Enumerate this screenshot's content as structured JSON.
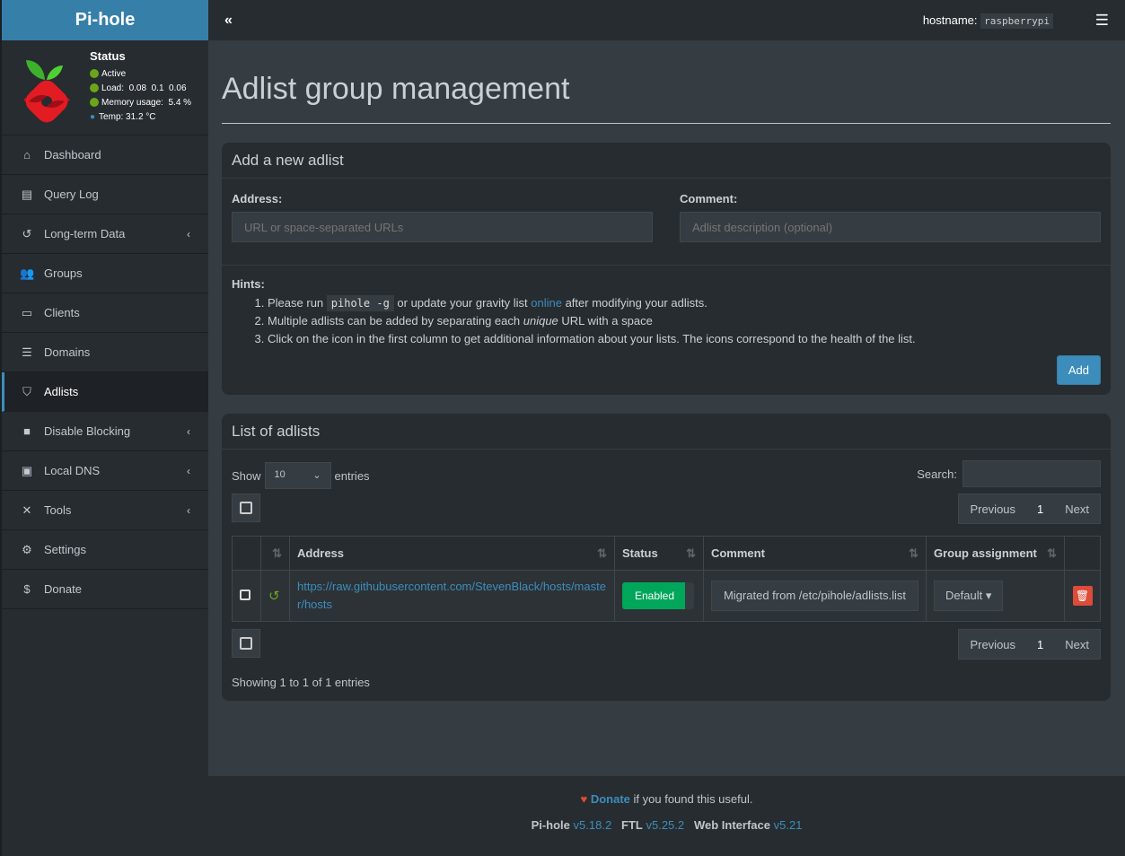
{
  "brand": "Pi-hole",
  "status": {
    "title": "Status",
    "active": "Active",
    "load": "Load:  0.08  0.1  0.06",
    "memory": "Memory usage:  5.4 %",
    "temp": "Temp: 31.2 °C"
  },
  "sidebar": {
    "items": [
      {
        "label": "Dashboard",
        "icon": "home-icon"
      },
      {
        "label": "Query Log",
        "icon": "file-icon"
      },
      {
        "label": "Long-term Data",
        "icon": "history-icon",
        "chevron": true
      },
      {
        "label": "Groups",
        "icon": "users-icon"
      },
      {
        "label": "Clients",
        "icon": "laptop-icon"
      },
      {
        "label": "Domains",
        "icon": "list-icon"
      },
      {
        "label": "Adlists",
        "icon": "shield-icon",
        "active": true
      },
      {
        "label": "Disable Blocking",
        "icon": "stop-icon",
        "chevron": true
      },
      {
        "label": "Local DNS",
        "icon": "address-book-icon",
        "chevron": true
      },
      {
        "label": "Tools",
        "icon": "tools-icon",
        "chevron": true
      },
      {
        "label": "Settings",
        "icon": "gear-icon"
      },
      {
        "label": "Donate",
        "icon": "donate-icon"
      }
    ]
  },
  "topbar": {
    "hostname_label": "hostname:",
    "hostname": "raspberrypi"
  },
  "page_title": "Adlist group management",
  "add_box": {
    "title": "Add a new adlist",
    "address_label": "Address:",
    "address_placeholder": "URL or space-separated URLs",
    "comment_label": "Comment:",
    "comment_placeholder": "Adlist description (optional)",
    "hints_label": "Hints:",
    "hint1_a": "Please run ",
    "hint1_code": "pihole -g",
    "hint1_b": " or update your gravity list ",
    "hint1_link": "online",
    "hint1_c": " after modifying your adlists.",
    "hint2_a": "Multiple adlists can be added by separating each ",
    "hint2_em": "unique",
    "hint2_b": " URL with a space",
    "hint3": "Click on the icon in the first column to get additional information about your lists. The icons correspond to the health of the list.",
    "add_button": "Add"
  },
  "list_box": {
    "title": "List of adlists",
    "show": "Show",
    "entries_value": "10",
    "entries": "entries",
    "search_label": "Search:",
    "previous": "Previous",
    "page": "1",
    "next": "Next",
    "columns": [
      "Address",
      "Status",
      "Comment",
      "Group assignment"
    ],
    "rows": [
      {
        "address": "https://raw.githubusercontent.com/StevenBlack/hosts/master/hosts",
        "status": "Enabled",
        "comment": "Migrated from /etc/pihole/adlists.list",
        "group": "Default"
      }
    ],
    "showing": "Showing 1 to 1 of 1 entries"
  },
  "footer": {
    "donate": "Donate",
    "donate_rest": " if you found this useful.",
    "pihole": "Pi-hole",
    "pihole_v": "v5.18.2",
    "ftl": "FTL",
    "ftl_v": "v5.25.2",
    "web": "Web Interface",
    "web_v": "v5.21"
  },
  "colors": {
    "accent": "#3c8dbc",
    "enabled": "#00a65a",
    "delete": "#dd4b39",
    "status_ok": "#6aa51c"
  }
}
